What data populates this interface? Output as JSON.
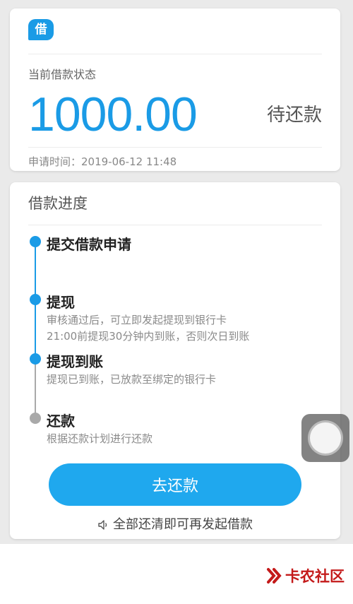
{
  "status_card": {
    "logo_char": "借",
    "status_label": "当前借款状态",
    "amount": "1000.00",
    "status_value": "待还款",
    "apply_time": "申请时间：2019-06-12 11:48"
  },
  "progress_card": {
    "title": "借款进度",
    "steps": [
      {
        "title": "提交借款申请",
        "desc": [],
        "state": "done"
      },
      {
        "title": "提现",
        "desc": [
          "审核通过后，可立即发起提现到银行卡",
          "21:00前提现30分钟内到账，否则次日到账"
        ],
        "state": "done"
      },
      {
        "title": "提现到账",
        "desc": [
          "提现已到账，已放款至绑定的银行卡"
        ],
        "state": "done"
      },
      {
        "title": "还款",
        "desc": [
          "根据还款计划进行还款"
        ],
        "state": "pending"
      }
    ],
    "repay_button": "去还款",
    "notice": "全部还清即可再发起借款"
  },
  "watermark": {
    "text": "卡农社区"
  },
  "colors": {
    "accent": "#1a9be6",
    "button": "#1fa8ee",
    "done_dot": "#1a9be6",
    "pending_dot": "#a9a9a9",
    "watermark": "#c41a1a"
  },
  "icons": [
    "speaker-icon",
    "floating-assistive-touch-icon",
    "kanong-logo-icon"
  ]
}
